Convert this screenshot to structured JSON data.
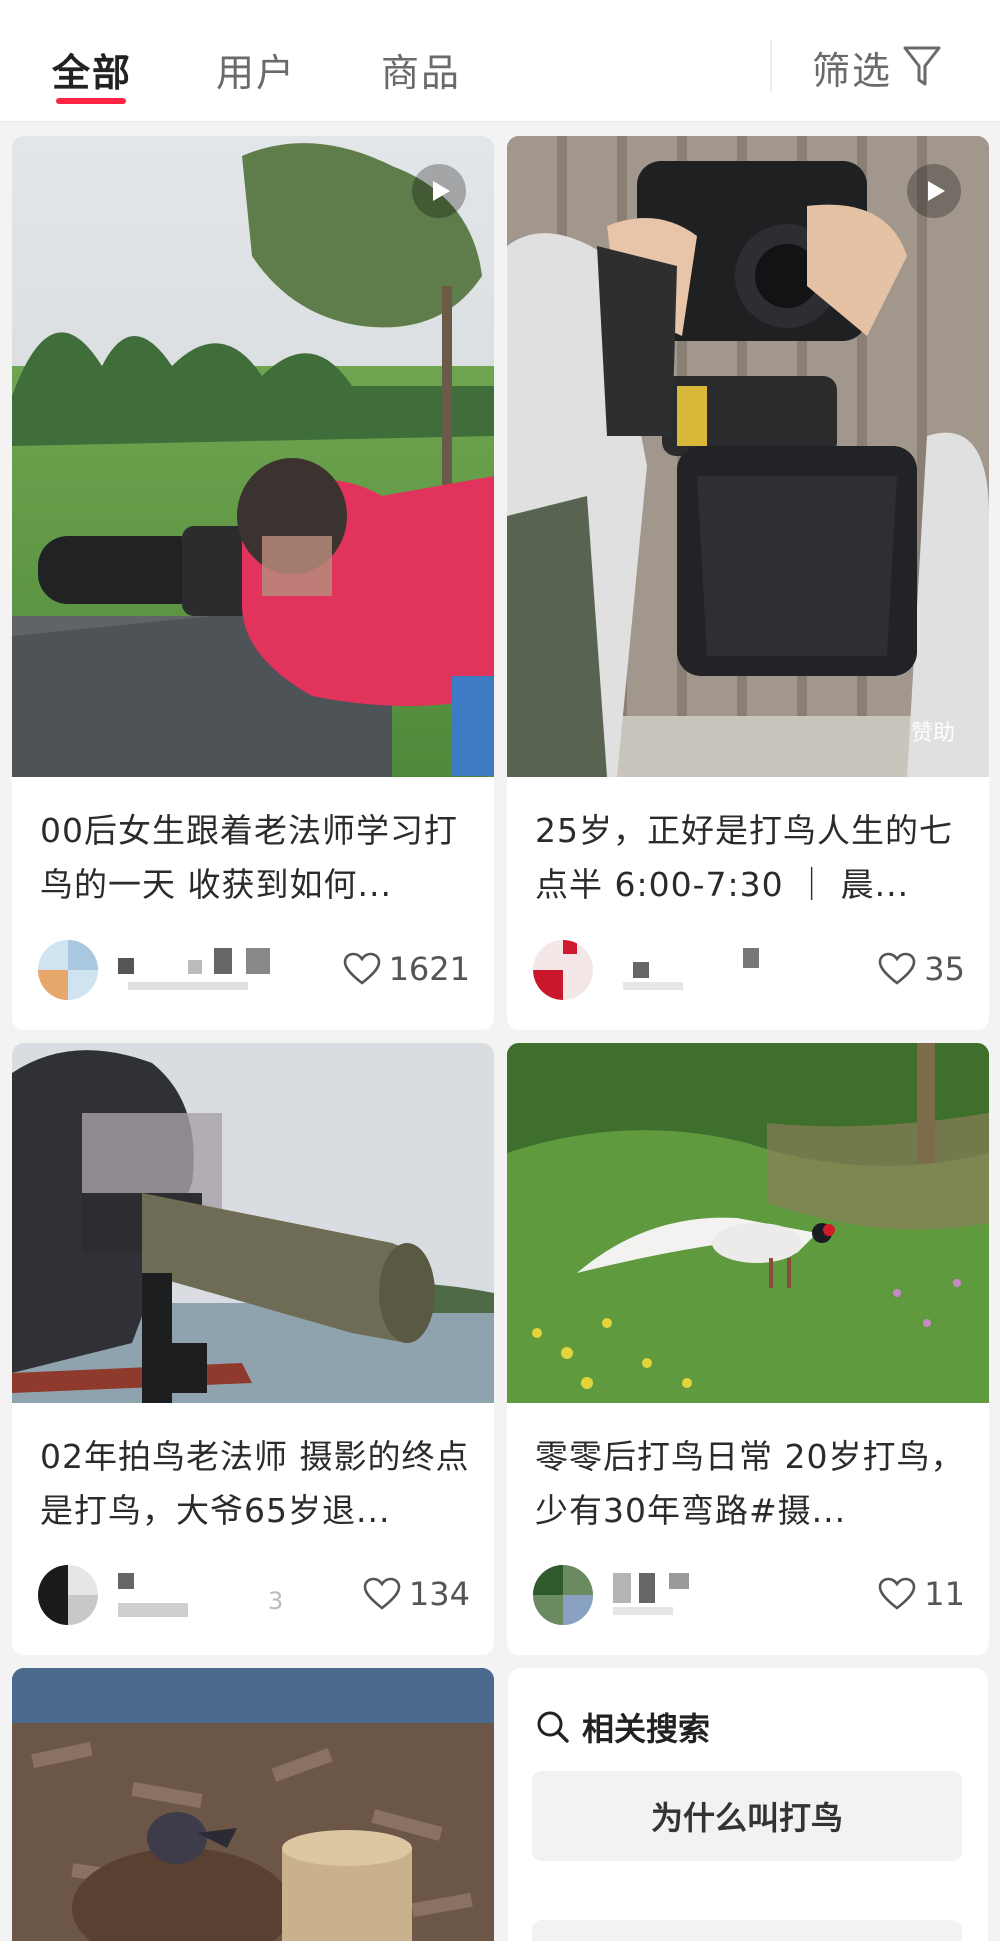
{
  "tabs": [
    {
      "label": "全部",
      "active": true
    },
    {
      "label": "用户",
      "active": false
    },
    {
      "label": "商品",
      "active": false
    }
  ],
  "filter": {
    "label": "筛选",
    "icon": "funnel-icon"
  },
  "cards": [
    {
      "title": "00后女生跟着老法师学习打鸟的一天 收获到如何...",
      "likes": "1621",
      "has_video": true
    },
    {
      "title": "25岁，正好是打鸟人生的七点半 6:00-7:30 ｜ 晨...",
      "likes": "35",
      "has_video": true,
      "sponsor": "赞助"
    },
    {
      "title": "02年拍鸟老法师 摄影的终点是打鸟，大爷65岁退...",
      "likes": "134",
      "has_video": false,
      "date_fragment": "3"
    },
    {
      "title": "零零后打鸟日常 20岁打鸟，少有30年弯路#摄...",
      "likes": "11",
      "has_video": false
    }
  ],
  "related": {
    "heading": "相关搜索",
    "items": [
      "为什么叫打鸟"
    ]
  },
  "colors": {
    "accent": "#ff2442",
    "background": "#f3f3f3",
    "card": "#ffffff"
  }
}
